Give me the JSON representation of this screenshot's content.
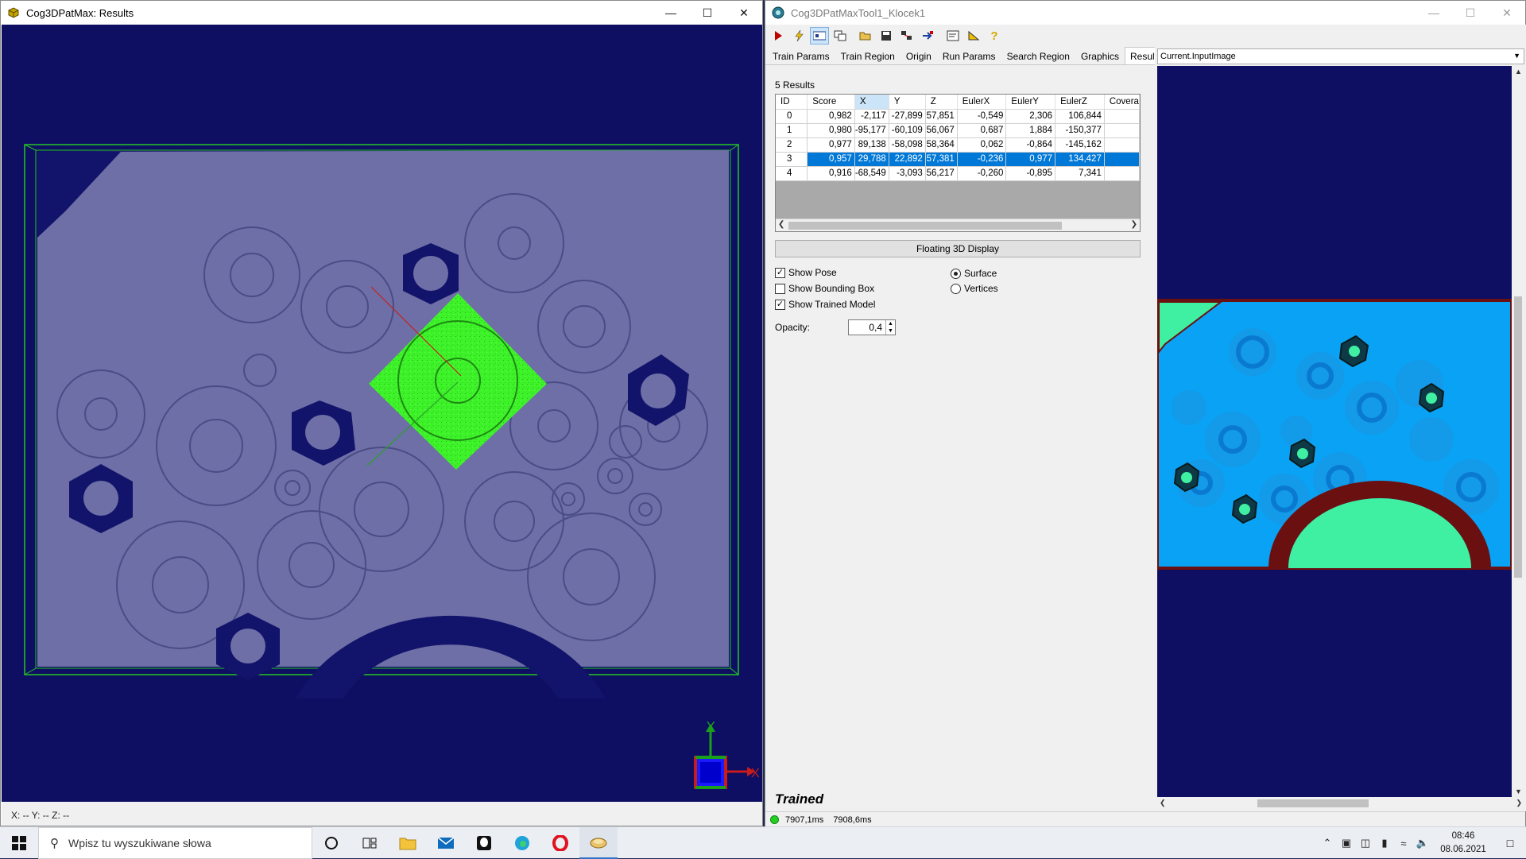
{
  "left_window": {
    "title": "Cog3DPatMax: Results",
    "status": "X: --  Y: --  Z: --",
    "axis_y": "Y",
    "axis_x": "X"
  },
  "right_window": {
    "title": "Cog3DPatMaxTool1_Klocek1",
    "tabs": [
      "Train Params",
      "Train Region",
      "Origin",
      "Run Params",
      "Search Region",
      "Graphics",
      "Results"
    ],
    "selected_tab": "Results",
    "results_count": "5 Results",
    "columns": [
      "ID",
      "Score",
      "X",
      "Y",
      "Z",
      "EulerX",
      "EulerY",
      "EulerZ",
      "Covera"
    ],
    "rows": [
      [
        "0",
        "0,982",
        "-2,117",
        "-27,899",
        "57,851",
        "-0,549",
        "2,306",
        "106,844"
      ],
      [
        "1",
        "0,980",
        "-95,177",
        "-60,109",
        "56,067",
        "0,687",
        "1,884",
        "-150,377"
      ],
      [
        "2",
        "0,977",
        "89,138",
        "-58,098",
        "58,364",
        "0,062",
        "-0,864",
        "-145,162"
      ],
      [
        "3",
        "0,957",
        "29,788",
        "22,892",
        "57,381",
        "-0,236",
        "0,977",
        "134,427"
      ],
      [
        "4",
        "0,916",
        "-68,549",
        "-3,093",
        "56,217",
        "-0,260",
        "-0,895",
        "7,341"
      ]
    ],
    "selected_row": 3,
    "floating_button": "Floating 3D Display",
    "show_pose": "Show Pose",
    "show_bounding_box": "Show Bounding Box",
    "show_trained_model": "Show Trained Model",
    "surface": "Surface",
    "vertices": "Vertices",
    "opacity_label": "Opacity:",
    "opacity_value": "0,4",
    "trained_label": "Trained",
    "image_select": "Current.InputImage",
    "status_time1": "7907,1ms",
    "status_time2": "7908,6ms"
  },
  "taskbar": {
    "search_placeholder": "Wpisz tu wyszukiwane słowa",
    "time": "08:46",
    "date": "08.06.2021"
  },
  "colors": {
    "view_bg": "#0e0f63",
    "surface": "#6d6fa6",
    "model": "#3ef22a",
    "selection": "#0078d7",
    "depth_bg": "#0aa2f5",
    "depth_border": "#6b1010",
    "depth_green": "#3ff0a2"
  },
  "icons": [
    "windows-icon",
    "search-icon",
    "task-view-icon",
    "file-explorer-icon",
    "mail-icon",
    "edge-icon",
    "opera-icon"
  ]
}
